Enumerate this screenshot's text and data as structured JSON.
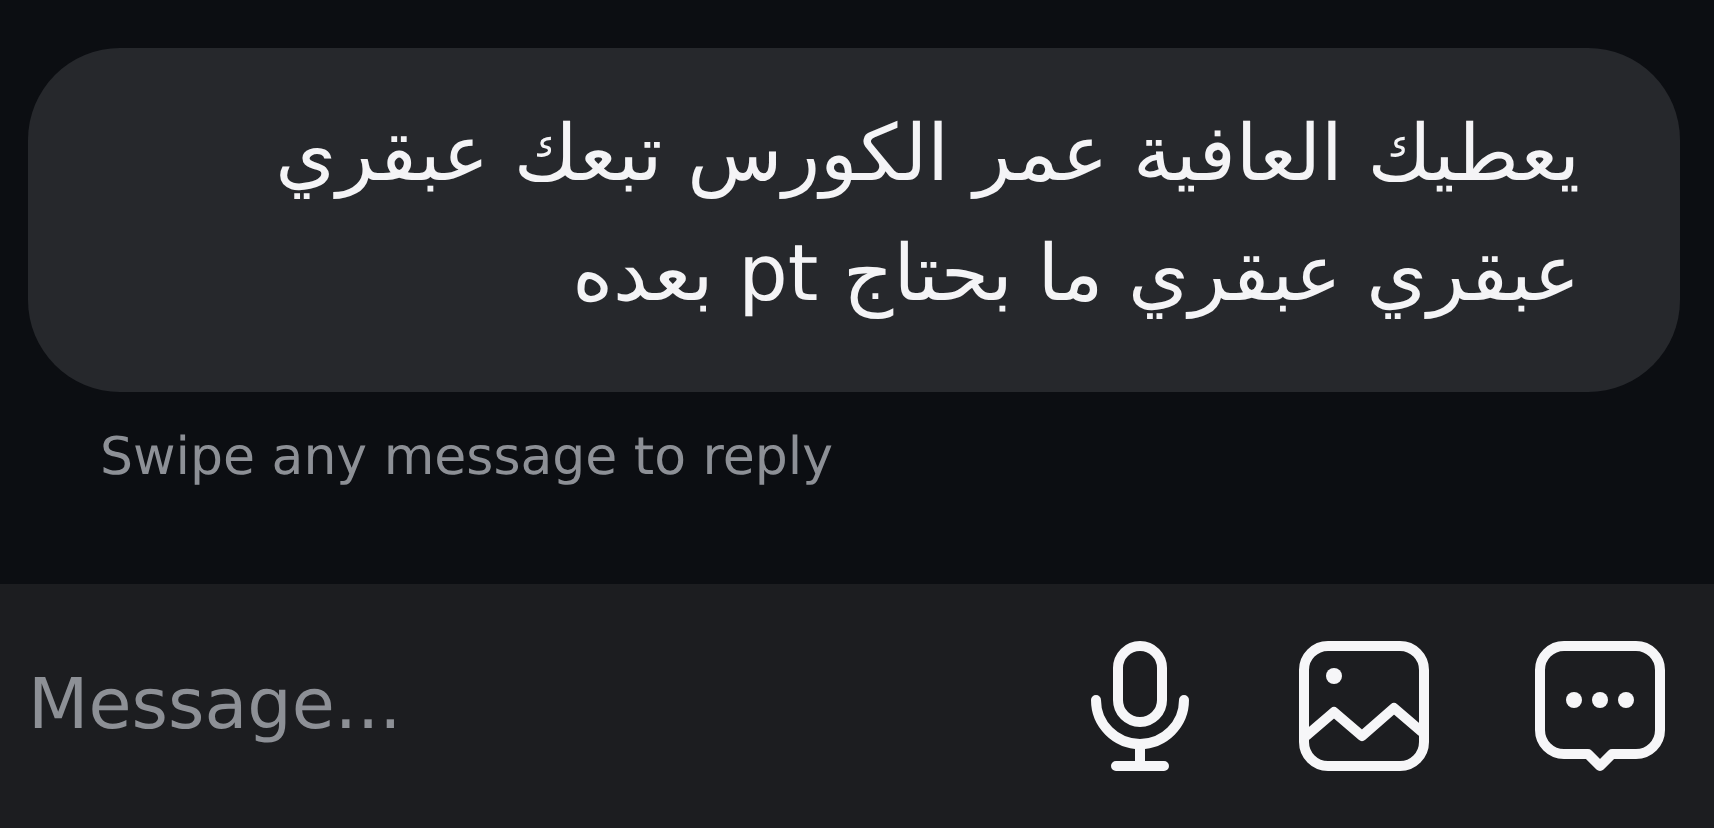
{
  "message": {
    "text": "يعطيك العافية عمر الكورس تبعك عبقري عبقري عبقري ما بحتاج pt بعده"
  },
  "hint": "Swipe any message to reply",
  "composer": {
    "placeholder": "Message..."
  }
}
